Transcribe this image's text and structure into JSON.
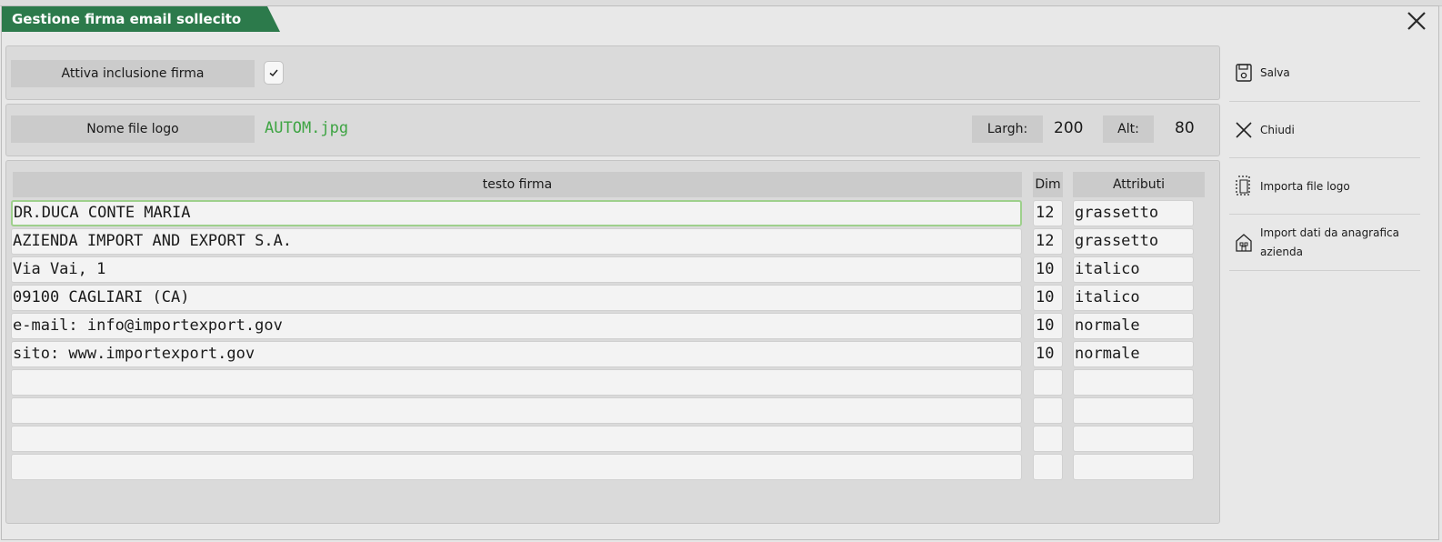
{
  "window": {
    "title": "Gestione firma email sollecito"
  },
  "settings": {
    "include_label": "Attiva inclusione firma",
    "include_checked": true
  },
  "logo": {
    "file_label": "Nome file logo",
    "file_value": "AUTOM.jpg",
    "width_label": "Largh:",
    "width_value": "200",
    "height_label": "Alt:",
    "height_value": "80"
  },
  "table": {
    "headers": {
      "text": "testo firma",
      "dim": "Dim",
      "attributes": "Attributi"
    },
    "rows": [
      {
        "text": "DR.DUCA CONTE MARIA",
        "dim": "12",
        "attr": "grassetto"
      },
      {
        "text": "AZIENDA IMPORT AND EXPORT S.A.",
        "dim": "12",
        "attr": "grassetto"
      },
      {
        "text": "Via Vai, 1",
        "dim": "10",
        "attr": "italico"
      },
      {
        "text": "09100 CAGLIARI (CA)",
        "dim": "10",
        "attr": "italico"
      },
      {
        "text": "e-mail: info@importexport.gov",
        "dim": "10",
        "attr": "normale"
      },
      {
        "text": "sito: www.importexport.gov",
        "dim": "10",
        "attr": "normale"
      },
      {
        "text": "",
        "dim": "",
        "attr": ""
      },
      {
        "text": "",
        "dim": "",
        "attr": ""
      },
      {
        "text": "",
        "dim": "",
        "attr": ""
      },
      {
        "text": "",
        "dim": "",
        "attr": ""
      }
    ]
  },
  "sidebar": {
    "save": {
      "label": "Salva",
      "icon": "save-icon"
    },
    "close": {
      "label": "Chiudi",
      "icon": "close-icon"
    },
    "import_logo": {
      "label": "Importa file logo",
      "icon": "import-file-icon"
    },
    "import_company": {
      "label_line1": "Import dati da anagrafica",
      "label_line2": "azienda",
      "icon": "company-building-icon"
    }
  },
  "colors": {
    "title_bar": "#2c7a4b",
    "file_value": "#3ea443",
    "active_border": "#9ed08c"
  }
}
